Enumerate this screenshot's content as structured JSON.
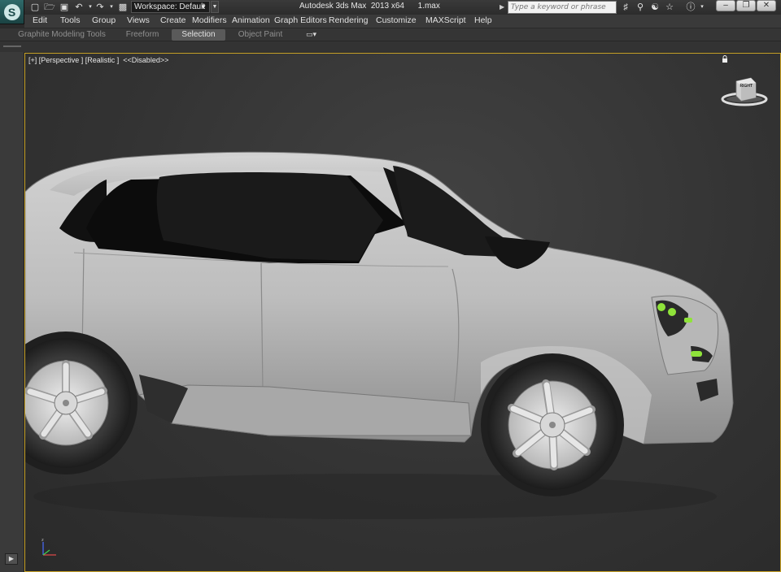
{
  "titlebar": {
    "app_title": "Autodesk 3ds Max  2013 x64      1.max",
    "workspace_label": "Workspace: Default",
    "search_placeholder": "Type a keyword or phrase",
    "quick_access_icons": [
      "new-file-icon",
      "open-folder-icon",
      "save-icon",
      "undo-icon",
      "redo-icon",
      "hold-icon"
    ],
    "info_icons": [
      "binoculars-icon",
      "key-icon",
      "favorites-star-icon",
      "help-icon"
    ],
    "window_buttons": [
      "minimize",
      "restore",
      "close"
    ]
  },
  "menubar": {
    "items": [
      "Edit",
      "Tools",
      "Group",
      "Views",
      "Create",
      "Modifiers",
      "Animation",
      "Graph Editors",
      "Rendering",
      "Customize",
      "MAXScript",
      "Help"
    ]
  },
  "ribbon": {
    "tabs": [
      "Graphite Modeling Tools",
      "Freeform",
      "Selection",
      "Object Paint"
    ],
    "active_tab": "Selection"
  },
  "viewport": {
    "label": "[+] [Perspective ] [Realistic ]  <<Disabled>>",
    "viewcube_face": "RIGHT",
    "active_border_color": "#c8a227",
    "object": "car-model-suv-side-view"
  },
  "colors": {
    "background": "#2b2b2b",
    "menubar": "#3a3a3a",
    "viewport_highlight": "#c8a227",
    "headlight_green": "#8fe33a"
  }
}
